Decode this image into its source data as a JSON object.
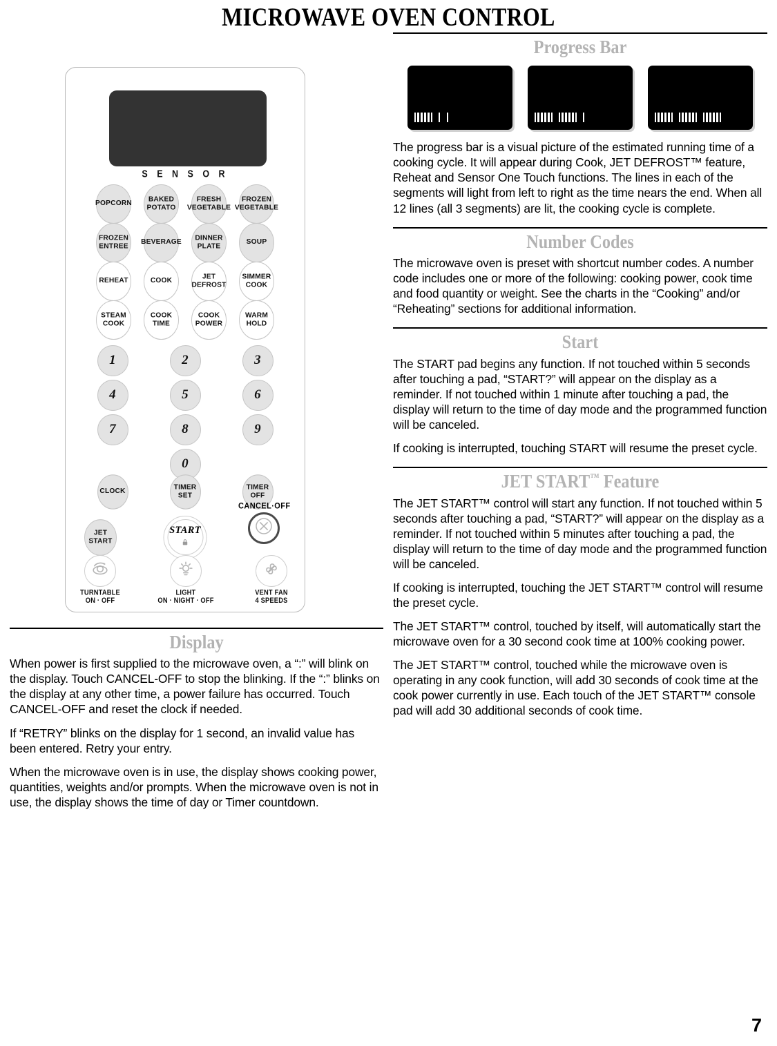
{
  "page": {
    "title": "MICROWAVE OVEN CONTROL",
    "number": "7"
  },
  "control_panel": {
    "display_window_label": "display-window",
    "sensor_header": "S E N S O R",
    "sensor_pads": [
      [
        {
          "label": "POPCORN",
          "filled": true
        },
        {
          "label": "BAKED\nPOTATO",
          "filled": true
        },
        {
          "label": "FRESH\nVEGETABLE",
          "filled": true
        },
        {
          "label": "FROZEN\nVEGETABLE",
          "filled": true
        }
      ],
      [
        {
          "label": "FROZEN\nENTREE",
          "filled": true
        },
        {
          "label": "BEVERAGE",
          "filled": true
        },
        {
          "label": "DINNER\nPLATE",
          "filled": true
        },
        {
          "label": "SOUP",
          "filled": true
        }
      ],
      [
        {
          "label": "REHEAT",
          "filled": false
        },
        {
          "label": "COOK",
          "filled": false
        },
        {
          "label": "JET\nDEFROST",
          "filled": false
        },
        {
          "label": "SIMMER\nCOOK",
          "filled": false
        }
      ],
      [
        {
          "label": "STEAM\nCOOK",
          "filled": false
        },
        {
          "label": "COOK\nTIME",
          "filled": false
        },
        {
          "label": "COOK\nPOWER",
          "filled": false
        },
        {
          "label": "WARM\nHOLD",
          "filled": false
        }
      ]
    ],
    "number_pads": [
      [
        "1",
        "2",
        "3"
      ],
      [
        "4",
        "5",
        "6"
      ],
      [
        "7",
        "8",
        "9"
      ],
      [
        "0"
      ]
    ],
    "clock_row": [
      {
        "label": "CLOCK"
      },
      {
        "label": "TIMER\nSET"
      },
      {
        "label": "TIMER\nOFF"
      }
    ],
    "jet_start_pad": "JET\nSTART",
    "start_pad": "START",
    "start_lock_icon": "lock-icon",
    "cancel_off_label": "CANCEL·OFF",
    "cancel_off_icon": "circle-x-icon",
    "utility_row": [
      {
        "icon": "turntable-icon",
        "label": "TURNTABLE\nON · OFF"
      },
      {
        "icon": "light-bulb-icon",
        "label": "LIGHT\nON · NIGHT · OFF"
      },
      {
        "icon": "vent-fan-icon",
        "label": "VENT FAN\n4 SPEEDS"
      }
    ]
  },
  "sections": {
    "display": {
      "heading": "Display",
      "paragraphs": [
        "When power is first supplied to the microwave oven, a “:” will blink on the display. Touch CANCEL-OFF to stop the blinking. If the “:” blinks on the display at any other time, a power failure has occurred. Touch CANCEL-OFF and reset the clock if needed.",
        "If “RETRY” blinks on the display for 1 second, an invalid value has been entered. Retry your entry.",
        "When the microwave oven is in use, the display shows cooking power, quantities, weights and/or prompts. When the microwave oven is not in use, the display shows the time of day or Timer countdown."
      ]
    },
    "progress_bar": {
      "heading": "Progress Bar",
      "paragraphs": [
        "The progress bar is a visual picture of the estimated running time of a cooking cycle. It will appear during Cook, JET DEFROST™ feature, Reheat and Sensor One Touch functions. The lines in each of the segments will light from left to right as the time nears the end. When all 12 lines (all 3 segments) are lit, the cooking cycle is complete."
      ]
    },
    "number_codes": {
      "heading": "Number Codes",
      "paragraphs": [
        "The microwave oven is preset with shortcut number codes. A number code includes one or more of the following: cooking power, cook time and food quantity or weight. See the charts in the “Cooking” and/or “Reheating” sections for additional information."
      ]
    },
    "start": {
      "heading": "Start",
      "paragraphs": [
        "The START pad begins any function. If not touched within 5 seconds after touching a pad, “START?” will appear on the display as a reminder. If not touched within 1 minute after touching a pad, the display will return to the time of day mode and the programmed function will be canceled.",
        "If cooking is interrupted, touching START will resume the preset cycle."
      ]
    },
    "jet_start": {
      "heading_main": "JET START",
      "heading_tm": "™",
      "heading_suffix": " Feature",
      "paragraphs": [
        "The JET START™ control will start any function. If not touched within 5 seconds after touching a pad, “START?” will appear on the display as a reminder. If not touched within 5 minutes after touching a pad, the display will return to the time of day mode and the programmed function will be canceled.",
        "If cooking is interrupted, touching the JET START™ control will resume the preset cycle.",
        "The JET START™ control, touched by itself, will automatically start the microwave oven for a 30 second cook time at 100% cooking power.",
        "The JET START™ control, touched while the microwave oven is operating in any cook function, will add 30 seconds of cook time at the cook power currently in use. Each touch of the JET START™ console pad will add 30 additional seconds of cook time."
      ]
    }
  },
  "progress_bar_graphics": {
    "total_lines": 12,
    "segments_per_bar": 3,
    "lines_per_segment": 4,
    "bars": [
      {
        "lit_segments": 1,
        "caption": "one-segment-lit"
      },
      {
        "lit_segments": 2,
        "caption": "two-segments-lit"
      },
      {
        "lit_segments": 3,
        "caption": "three-segments-lit"
      }
    ]
  }
}
